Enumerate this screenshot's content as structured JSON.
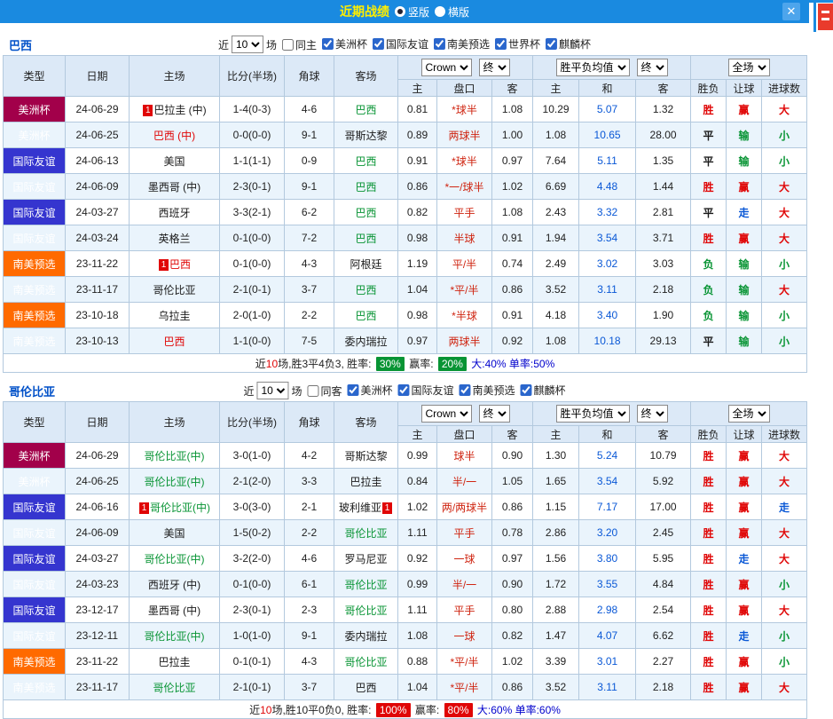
{
  "titlebar": {
    "title": "近期战绩",
    "vertical": "竖版",
    "horizontal": "横版",
    "close": "✕"
  },
  "ui": {
    "near": "近",
    "games": "场"
  },
  "table_headers": {
    "left": [
      "类型",
      "日期",
      "主场",
      "比分(半场)",
      "角球",
      "客场"
    ],
    "sub": [
      "主",
      "盘口",
      "客",
      "主",
      "和",
      "客",
      "胜负",
      "让球",
      "进球数"
    ],
    "bookmaker": "Crown",
    "final": "终",
    "europe": "胜平负均值",
    "scope": "全场"
  },
  "sections": [
    {
      "team": "巴西",
      "count": "10",
      "same_label": "同主",
      "cups": [
        "美洲杯",
        "国际友谊",
        "南美预选",
        "世界杯",
        "麒麟杯"
      ],
      "rows": [
        {
          "cup": "美洲杯",
          "cupc": "america",
          "date": "24-06-29",
          "home": [
            "巴拉圭 (中)",
            "k",
            1
          ],
          "score": "1-4(0-3)",
          "corner": "4-6",
          "away": [
            "巴西",
            "g",
            0
          ],
          "o1": "0.81",
          "hc": "*球半",
          "o2": "1.08",
          "w": "10.29",
          "d": "5.07",
          "l": "1.32",
          "res": [
            "胜",
            "r"
          ],
          "cov": [
            "赢",
            "r"
          ],
          "size": [
            "大",
            "r"
          ]
        },
        {
          "cup": "美洲杯",
          "cupc": "america",
          "date": "24-06-25",
          "home": [
            "巴西 (中)",
            "r",
            0
          ],
          "score": "0-0(0-0)",
          "corner": "9-1",
          "away": [
            "哥斯达黎",
            "k",
            0
          ],
          "o1": "0.89",
          "hc": "两球半",
          "o2": "1.00",
          "w": "1.08",
          "d": "10.65",
          "l": "28.00",
          "res": [
            "平",
            "k"
          ],
          "cov": [
            "输",
            "g"
          ],
          "size": [
            "小",
            "g"
          ]
        },
        {
          "cup": "国际友谊",
          "cupc": "friendly",
          "date": "24-06-13",
          "home": [
            "美国",
            "k",
            0
          ],
          "score": "1-1(1-1)",
          "corner": "0-9",
          "away": [
            "巴西",
            "g",
            0
          ],
          "o1": "0.91",
          "hc": "*球半",
          "o2": "0.97",
          "w": "7.64",
          "d": "5.11",
          "l": "1.35",
          "res": [
            "平",
            "k"
          ],
          "cov": [
            "输",
            "g"
          ],
          "size": [
            "小",
            "g"
          ]
        },
        {
          "cup": "国际友谊",
          "cupc": "friendly",
          "date": "24-06-09",
          "home": [
            "墨西哥 (中)",
            "k",
            0
          ],
          "score": "2-3(0-1)",
          "corner": "9-1",
          "away": [
            "巴西",
            "g",
            0
          ],
          "o1": "0.86",
          "hc": "*一/球半",
          "o2": "1.02",
          "w": "6.69",
          "d": "4.48",
          "l": "1.44",
          "res": [
            "胜",
            "r"
          ],
          "cov": [
            "赢",
            "r"
          ],
          "size": [
            "大",
            "r"
          ]
        },
        {
          "cup": "国际友谊",
          "cupc": "friendly",
          "date": "24-03-27",
          "home": [
            "西班牙",
            "k",
            0
          ],
          "score": "3-3(2-1)",
          "corner": "6-2",
          "away": [
            "巴西",
            "g",
            0
          ],
          "o1": "0.82",
          "hc": "平手",
          "o2": "1.08",
          "w": "2.43",
          "d": "3.32",
          "l": "2.81",
          "res": [
            "平",
            "k"
          ],
          "cov": [
            "走",
            "b"
          ],
          "size": [
            "大",
            "r"
          ]
        },
        {
          "cup": "国际友谊",
          "cupc": "friendly",
          "date": "24-03-24",
          "home": [
            "英格兰",
            "k",
            0
          ],
          "score": "0-1(0-0)",
          "corner": "7-2",
          "away": [
            "巴西",
            "g",
            0
          ],
          "o1": "0.98",
          "hc": "半球",
          "o2": "0.91",
          "w": "1.94",
          "d": "3.54",
          "l": "3.71",
          "res": [
            "胜",
            "r"
          ],
          "cov": [
            "赢",
            "r"
          ],
          "size": [
            "大",
            "r"
          ]
        },
        {
          "cup": "南美预选",
          "cupc": "south",
          "date": "23-11-22",
          "home": [
            "巴西",
            "r",
            1
          ],
          "score": "0-1(0-0)",
          "corner": "4-3",
          "away": [
            "阿根廷",
            "k",
            0
          ],
          "o1": "1.19",
          "hc": "平/半",
          "o2": "0.74",
          "w": "2.49",
          "d": "3.02",
          "l": "3.03",
          "res": [
            "负",
            "g"
          ],
          "cov": [
            "输",
            "g"
          ],
          "size": [
            "小",
            "g"
          ]
        },
        {
          "cup": "南美预选",
          "cupc": "south",
          "date": "23-11-17",
          "home": [
            "哥伦比亚",
            "k",
            0
          ],
          "score": "2-1(0-1)",
          "corner": "3-7",
          "away": [
            "巴西",
            "g",
            0
          ],
          "o1": "1.04",
          "hc": "*平/半",
          "o2": "0.86",
          "w": "3.52",
          "d": "3.11",
          "l": "2.18",
          "res": [
            "负",
            "g"
          ],
          "cov": [
            "输",
            "g"
          ],
          "size": [
            "大",
            "r"
          ]
        },
        {
          "cup": "南美预选",
          "cupc": "south",
          "date": "23-10-18",
          "home": [
            "乌拉圭",
            "k",
            0
          ],
          "score": "2-0(1-0)",
          "corner": "2-2",
          "away": [
            "巴西",
            "g",
            0
          ],
          "o1": "0.98",
          "hc": "*半球",
          "o2": "0.91",
          "w": "4.18",
          "d": "3.40",
          "l": "1.90",
          "res": [
            "负",
            "g"
          ],
          "cov": [
            "输",
            "g"
          ],
          "size": [
            "小",
            "g"
          ]
        },
        {
          "cup": "南美预选",
          "cupc": "south",
          "date": "23-10-13",
          "home": [
            "巴西",
            "r",
            0
          ],
          "score": "1-1(0-0)",
          "corner": "7-5",
          "away": [
            "委内瑞拉",
            "k",
            0
          ],
          "o1": "0.97",
          "hc": "两球半",
          "o2": "0.92",
          "w": "1.08",
          "d": "10.18",
          "l": "29.13",
          "res": [
            "平",
            "k"
          ],
          "cov": [
            "输",
            "g"
          ],
          "size": [
            "小",
            "g"
          ]
        }
      ],
      "footer": [
        [
          "近",
          "k"
        ],
        [
          "10",
          "rt"
        ],
        [
          "场,胜3平4负3, 胜率: ",
          "k"
        ],
        [
          "30%",
          "bg-green"
        ],
        [
          " 赢率: ",
          "k"
        ],
        [
          "20%",
          "bg-green"
        ],
        [
          " 大:40% 单率:50%",
          "bt"
        ]
      ]
    },
    {
      "team": "哥伦比亚",
      "count": "10",
      "same_label": "同客",
      "cups": [
        "美洲杯",
        "国际友谊",
        "南美预选",
        "麒麟杯"
      ],
      "rows": [
        {
          "cup": "美洲杯",
          "cupc": "america",
          "date": "24-06-29",
          "home": [
            "哥伦比亚(中)",
            "g",
            0
          ],
          "score": "3-0(1-0)",
          "corner": "4-2",
          "away": [
            "哥斯达黎",
            "k",
            0
          ],
          "o1": "0.99",
          "hc": "球半",
          "o2": "0.90",
          "w": "1.30",
          "d": "5.24",
          "l": "10.79",
          "res": [
            "胜",
            "r"
          ],
          "cov": [
            "赢",
            "r"
          ],
          "size": [
            "大",
            "r"
          ]
        },
        {
          "cup": "美洲杯",
          "cupc": "america",
          "date": "24-06-25",
          "home": [
            "哥伦比亚(中)",
            "g",
            0
          ],
          "score": "2-1(2-0)",
          "corner": "3-3",
          "away": [
            "巴拉圭",
            "k",
            0
          ],
          "o1": "0.84",
          "hc": "半/一",
          "o2": "1.05",
          "w": "1.65",
          "d": "3.54",
          "l": "5.92",
          "res": [
            "胜",
            "r"
          ],
          "cov": [
            "赢",
            "r"
          ],
          "size": [
            "大",
            "r"
          ]
        },
        {
          "cup": "国际友谊",
          "cupc": "friendly",
          "date": "24-06-16",
          "home": [
            "哥伦比亚(中)",
            "g",
            1
          ],
          "score": "3-0(3-0)",
          "corner": "2-1",
          "away": [
            "玻利维亚",
            "k",
            2
          ],
          "o1": "1.02",
          "hc": "两/两球半",
          "o2": "0.86",
          "w": "1.15",
          "d": "7.17",
          "l": "17.00",
          "res": [
            "胜",
            "r"
          ],
          "cov": [
            "赢",
            "r"
          ],
          "size": [
            "走",
            "b"
          ]
        },
        {
          "cup": "国际友谊",
          "cupc": "friendly",
          "date": "24-06-09",
          "home": [
            "美国",
            "k",
            0
          ],
          "score": "1-5(0-2)",
          "corner": "2-2",
          "away": [
            "哥伦比亚",
            "g",
            0
          ],
          "o1": "1.11",
          "hc": "平手",
          "o2": "0.78",
          "w": "2.86",
          "d": "3.20",
          "l": "2.45",
          "res": [
            "胜",
            "r"
          ],
          "cov": [
            "赢",
            "r"
          ],
          "size": [
            "大",
            "r"
          ]
        },
        {
          "cup": "国际友谊",
          "cupc": "friendly",
          "date": "24-03-27",
          "home": [
            "哥伦比亚(中)",
            "g",
            0
          ],
          "score": "3-2(2-0)",
          "corner": "4-6",
          "away": [
            "罗马尼亚",
            "k",
            0
          ],
          "o1": "0.92",
          "hc": "一球",
          "o2": "0.97",
          "w": "1.56",
          "d": "3.80",
          "l": "5.95",
          "res": [
            "胜",
            "r"
          ],
          "cov": [
            "走",
            "b"
          ],
          "size": [
            "大",
            "r"
          ]
        },
        {
          "cup": "国际友谊",
          "cupc": "friendly",
          "date": "24-03-23",
          "home": [
            "西班牙 (中)",
            "k",
            0
          ],
          "score": "0-1(0-0)",
          "corner": "6-1",
          "away": [
            "哥伦比亚",
            "g",
            0
          ],
          "o1": "0.99",
          "hc": "半/一",
          "o2": "0.90",
          "w": "1.72",
          "d": "3.55",
          "l": "4.84",
          "res": [
            "胜",
            "r"
          ],
          "cov": [
            "赢",
            "r"
          ],
          "size": [
            "小",
            "g"
          ]
        },
        {
          "cup": "国际友谊",
          "cupc": "friendly",
          "date": "23-12-17",
          "home": [
            "墨西哥 (中)",
            "k",
            0
          ],
          "score": "2-3(0-1)",
          "corner": "2-3",
          "away": [
            "哥伦比亚",
            "g",
            0
          ],
          "o1": "1.11",
          "hc": "平手",
          "o2": "0.80",
          "w": "2.88",
          "d": "2.98",
          "l": "2.54",
          "res": [
            "胜",
            "r"
          ],
          "cov": [
            "赢",
            "r"
          ],
          "size": [
            "大",
            "r"
          ]
        },
        {
          "cup": "国际友谊",
          "cupc": "friendly",
          "date": "23-12-11",
          "home": [
            "哥伦比亚(中)",
            "g",
            0
          ],
          "score": "1-0(1-0)",
          "corner": "9-1",
          "away": [
            "委内瑞拉",
            "k",
            0
          ],
          "o1": "1.08",
          "hc": "一球",
          "o2": "0.82",
          "w": "1.47",
          "d": "4.07",
          "l": "6.62",
          "res": [
            "胜",
            "r"
          ],
          "cov": [
            "走",
            "b"
          ],
          "size": [
            "小",
            "g"
          ]
        },
        {
          "cup": "南美预选",
          "cupc": "south",
          "date": "23-11-22",
          "home": [
            "巴拉圭",
            "k",
            0
          ],
          "score": "0-1(0-1)",
          "corner": "4-3",
          "away": [
            "哥伦比亚",
            "g",
            0
          ],
          "o1": "0.88",
          "hc": "*平/半",
          "o2": "1.02",
          "w": "3.39",
          "d": "3.01",
          "l": "2.27",
          "res": [
            "胜",
            "r"
          ],
          "cov": [
            "赢",
            "r"
          ],
          "size": [
            "小",
            "g"
          ]
        },
        {
          "cup": "南美预选",
          "cupc": "south",
          "date": "23-11-17",
          "home": [
            "哥伦比亚",
            "g",
            0
          ],
          "score": "2-1(0-1)",
          "corner": "3-7",
          "away": [
            "巴西",
            "k",
            0
          ],
          "o1": "1.04",
          "hc": "*平/半",
          "o2": "0.86",
          "w": "3.52",
          "d": "3.11",
          "l": "2.18",
          "res": [
            "胜",
            "r"
          ],
          "cov": [
            "赢",
            "r"
          ],
          "size": [
            "大",
            "r"
          ]
        }
      ],
      "footer": [
        [
          "近",
          "k"
        ],
        [
          "10",
          "rt"
        ],
        [
          "场,胜10平0负0, 胜率: ",
          "k"
        ],
        [
          "100%",
          "bg-red"
        ],
        [
          " 赢率: ",
          "k"
        ],
        [
          "80%",
          "bg-red"
        ],
        [
          " 大:60% 单率:60%",
          "bt"
        ]
      ]
    }
  ]
}
